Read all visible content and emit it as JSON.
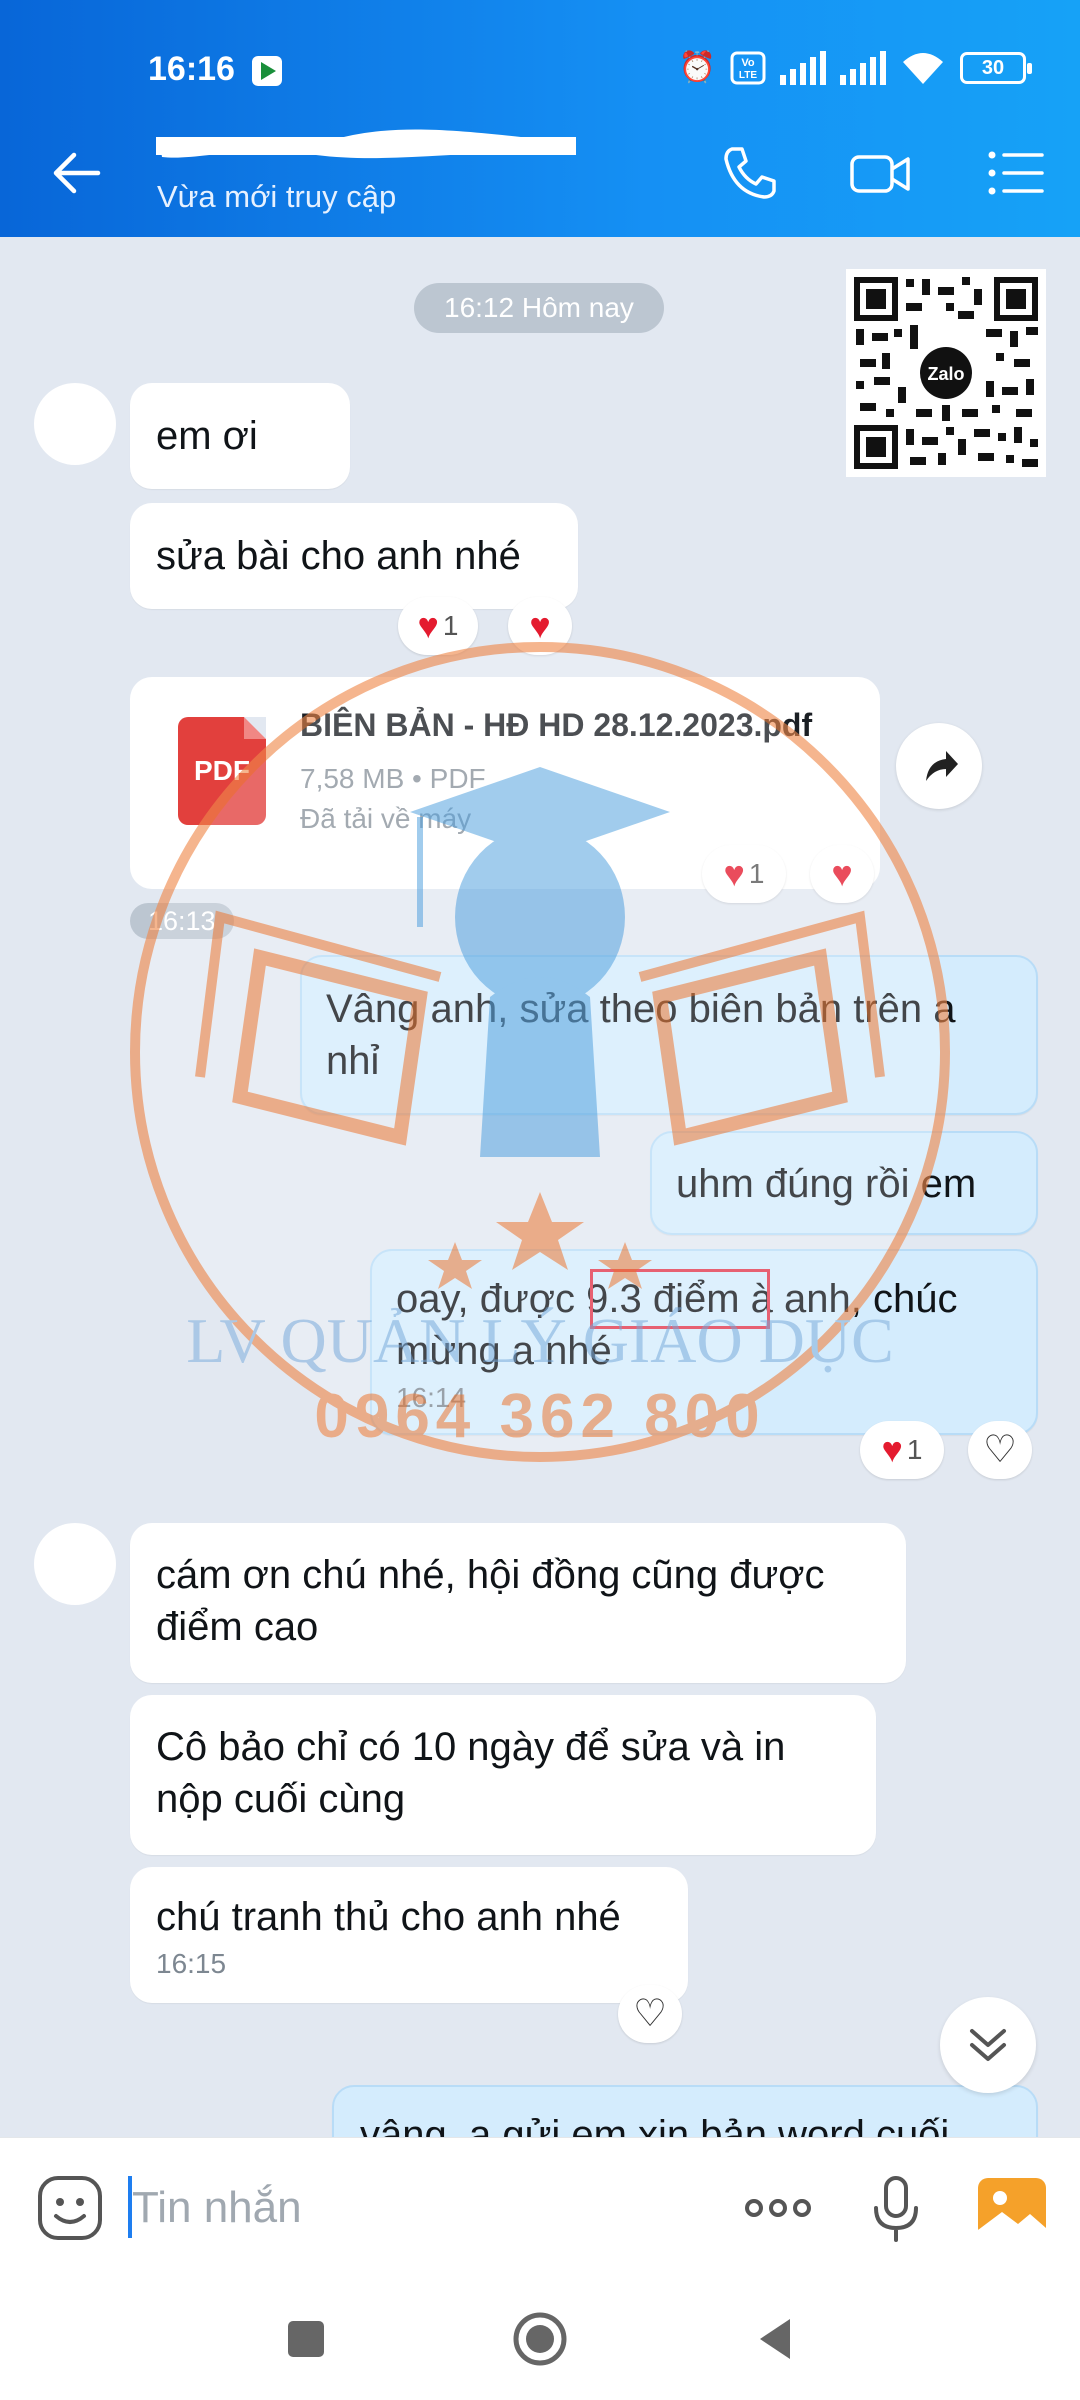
{
  "status_bar": {
    "time": "16:16",
    "battery": "30"
  },
  "header": {
    "subtitle": "Vừa mới truy cập",
    "icons": [
      "back-arrow-icon",
      "phone-icon",
      "video-call-icon",
      "menu-list-icon"
    ]
  },
  "chat": {
    "date_label": "16:12 Hôm nay",
    "qr_label": "Zalo",
    "messages": [
      {
        "side": "in",
        "text": "em ơi"
      },
      {
        "side": "in",
        "text": "sửa bài cho anh nhé",
        "reaction_count": "1"
      },
      {
        "side": "in",
        "type": "file",
        "file_name": "BIÊN BẢN - HĐ HD 28.12.2023.pdf",
        "file_meta": "7,58 MB • PDF",
        "file_status": "Đã tải về máy",
        "file_icon_label": "PDF",
        "reaction_count": "1"
      },
      {
        "time_label": "16:13"
      },
      {
        "side": "out",
        "text": "Vâng anh, sửa theo biên bản trên a nhỉ"
      },
      {
        "side": "out",
        "text": "uhm đúng rồi em"
      },
      {
        "side": "out",
        "text": "oay, được 9.3 điểm à anh, chúc mừng a nhé",
        "time": "16:14",
        "reaction_count": "1"
      },
      {
        "side": "in",
        "text": "cám ơn chú nhé, hội đồng cũng được điểm cao"
      },
      {
        "side": "in",
        "text": "Cô bảo chỉ có 10 ngày để sửa và in nộp cuối cùng"
      },
      {
        "side": "in",
        "text": "chú tranh thủ cho anh nhé",
        "time": "16:15"
      },
      {
        "side": "out",
        "text": "vâng, a gửi em xin bản word cuối"
      }
    ]
  },
  "watermark": {
    "line1": "LV QUẢN LÝ GIÁO DỤC",
    "line2": "0964 362 800"
  },
  "input": {
    "placeholder": "Tin nhắn"
  },
  "colors": {
    "header_start": "#0866d8",
    "header_end": "#16a2f7",
    "chat_bg": "#e2e8f1",
    "outgoing_bubble": "#d4ecfd",
    "heart": "#e41b2f",
    "watermark_orange": "#f0884a",
    "watermark_blue": "#69aee3"
  }
}
